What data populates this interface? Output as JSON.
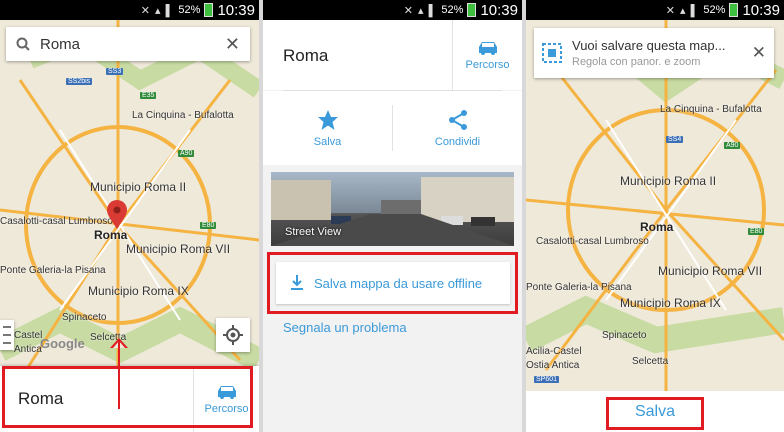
{
  "status_bar": {
    "battery": "52%",
    "time": "10:39"
  },
  "panel1": {
    "search_query": "Roma",
    "map_labels": {
      "la_cinquina": "La Cinquina - Bufalotta",
      "municipio_ii": "Municipio Roma II",
      "roma": "Roma",
      "municipio_vii": "Municipio Roma VII",
      "casal_lumbroso": "Casalotti-casal Lumbroso",
      "ponte_galeria": "Ponte Galeria-la Pisana",
      "municipio_ix": "Municipio Roma IX",
      "spinaceto": "Spinaceto",
      "selcetta": "Selcetta",
      "castel": "Castel",
      "antica": "Antica",
      "google": "Google",
      "ss3": "SS3",
      "e35": "E35",
      "ss2bis": "SS2bis",
      "a90": "A90",
      "e80": "E80"
    },
    "card_title": "Roma",
    "route_label": "Percorso"
  },
  "panel2": {
    "title": "Roma",
    "route_label": "Percorso",
    "save_label": "Salva",
    "share_label": "Condividi",
    "street_view_label": "Street View",
    "save_offline_label": "Salva mappa da usare offline",
    "report_label": "Segnala un problema"
  },
  "panel3": {
    "prompt_title": "Vuoi salvare questa map...",
    "prompt_subtitle": "Regola con panor. e zoom",
    "map_labels": {
      "la_cinquina": "La Cinquina - Bufalotta",
      "municipio_ii": "Municipio Roma II",
      "casal_lumbroso": "Casalotti-casal Lumbroso",
      "roma": "Roma",
      "municipio_vii": "Municipio Roma VII",
      "ponte_galeria": "Ponte Galeria-la Pisana",
      "municipio_ix": "Municipio Roma IX",
      "spinaceto": "Spinaceto",
      "acilia": "Acilia-Castel",
      "ostia": "Ostia Antica",
      "selcetta": "Selcetta",
      "ss4": "SS4",
      "a90": "A90",
      "e80": "E80",
      "sp601": "SP601"
    },
    "save_button": "Salva"
  },
  "colors": {
    "accent": "#3b9ad9",
    "highlight": "#e11b22",
    "map_road": "#f5b342",
    "map_park": "#c8dba2"
  }
}
